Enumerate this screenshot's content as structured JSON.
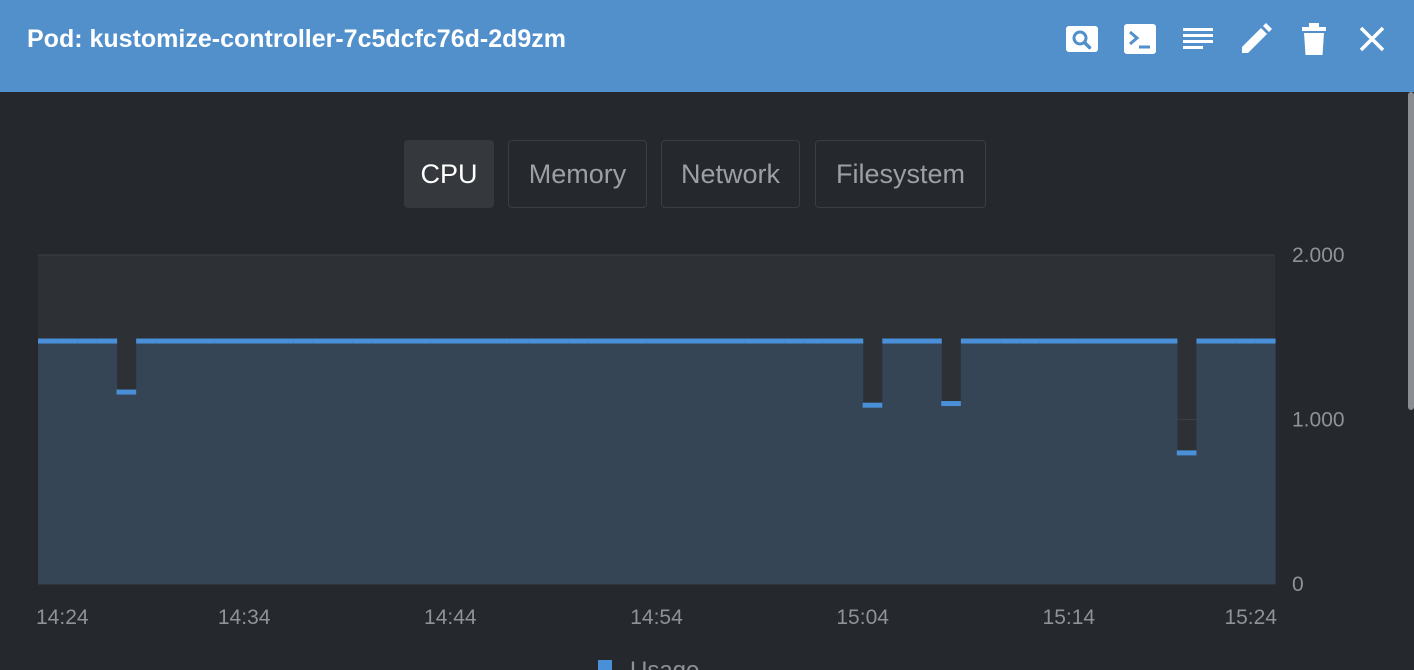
{
  "header": {
    "title": "Pod: kustomize-controller-7c5dcfc76d-2d9zm",
    "icons": [
      "search-icon",
      "terminal-icon",
      "logs-icon",
      "edit-icon",
      "delete-icon",
      "close-icon"
    ],
    "background": "#5190cb"
  },
  "tabs": [
    {
      "label": "CPU",
      "active": true
    },
    {
      "label": "Memory",
      "active": false
    },
    {
      "label": "Network",
      "active": false
    },
    {
      "label": "Filesystem",
      "active": false
    }
  ],
  "chart_data": {
    "type": "area",
    "xlabel": "",
    "ylabel": "",
    "ylim": [
      0,
      2
    ],
    "y_ticks": [
      "2.000",
      "1.000",
      "0"
    ],
    "y_tick_values": [
      2,
      1,
      0
    ],
    "x_ticks": [
      "14:24",
      "14:34",
      "14:44",
      "14:54",
      "15:04",
      "15:14",
      "15:24"
    ],
    "grid": true,
    "legend": "bottom",
    "color": "#4a90d9",
    "series": [
      {
        "name": "Usage",
        "values": [
          1.48,
          1.48,
          1.48,
          1.48,
          1.17,
          1.48,
          1.48,
          1.48,
          1.48,
          1.48,
          1.48,
          1.48,
          1.48,
          1.48,
          1.48,
          1.48,
          1.48,
          1.48,
          1.48,
          1.48,
          1.48,
          1.48,
          1.48,
          1.48,
          1.48,
          1.48,
          1.48,
          1.48,
          1.48,
          1.48,
          1.48,
          1.48,
          1.48,
          1.48,
          1.48,
          1.48,
          1.48,
          1.48,
          1.48,
          1.48,
          1.48,
          1.48,
          1.09,
          1.48,
          1.48,
          1.48,
          1.1,
          1.48,
          1.48,
          1.48,
          1.48,
          1.48,
          1.48,
          1.48,
          1.48,
          1.48,
          1.48,
          1.48,
          0.8,
          1.48,
          1.48,
          1.48,
          1.48
        ]
      }
    ]
  }
}
